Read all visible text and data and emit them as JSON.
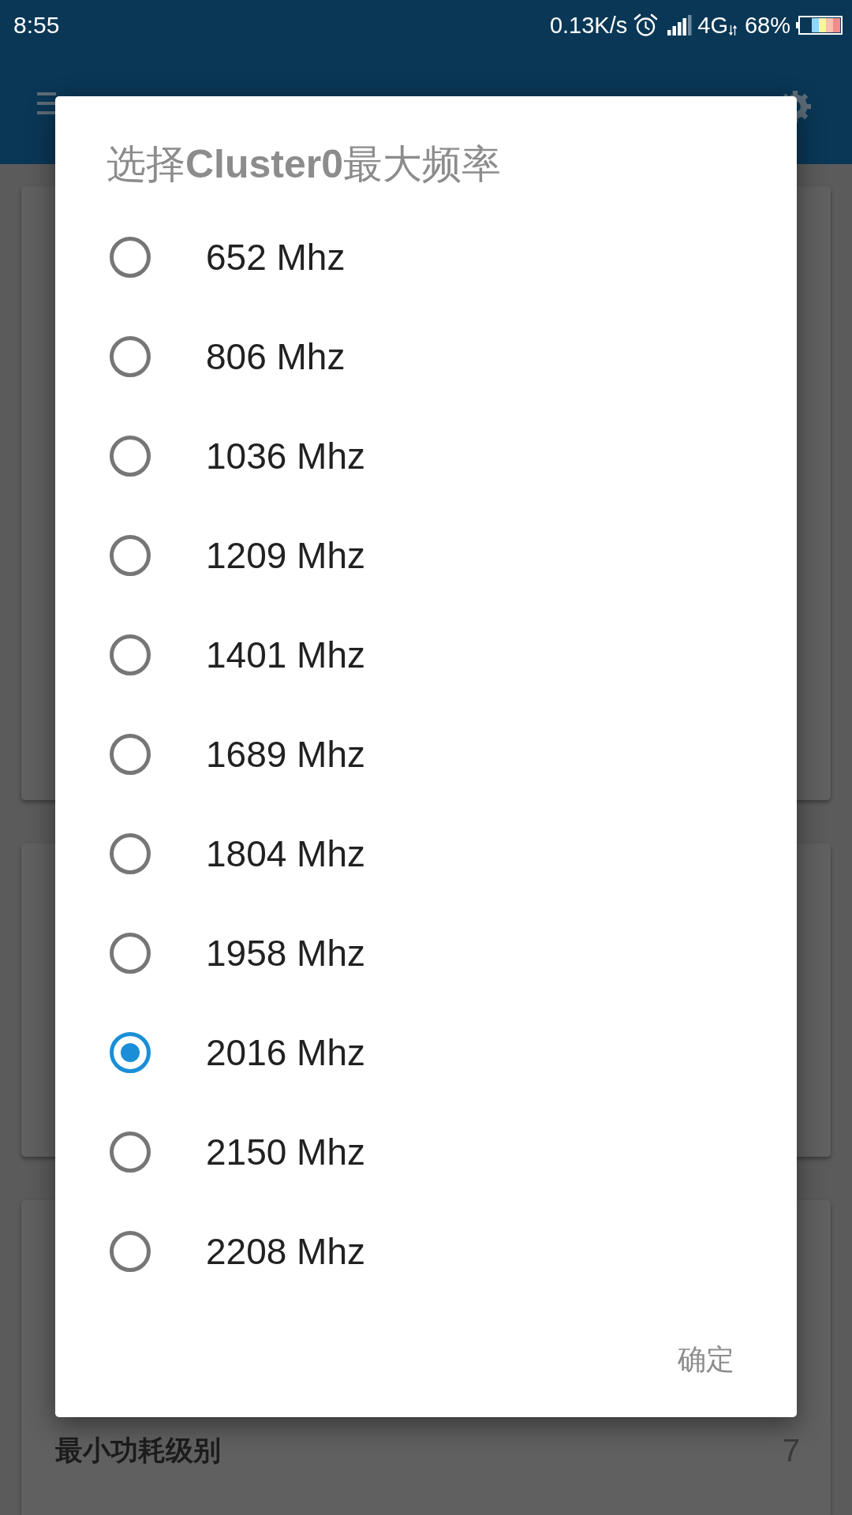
{
  "status_bar": {
    "time": "8:55",
    "network_speed": "0.13K/s",
    "network_type": "4G",
    "battery": "68%"
  },
  "background_rows": [
    {
      "label": "最小功耗级别",
      "value": "7"
    }
  ],
  "dialog": {
    "title": "选择**Cluster0**最大频率",
    "options": [
      {
        "label": "652 Mhz",
        "selected": false
      },
      {
        "label": "806 Mhz",
        "selected": false
      },
      {
        "label": "1036 Mhz",
        "selected": false
      },
      {
        "label": "1209 Mhz",
        "selected": false
      },
      {
        "label": "1401 Mhz",
        "selected": false
      },
      {
        "label": "1689 Mhz",
        "selected": false
      },
      {
        "label": "1804 Mhz",
        "selected": false
      },
      {
        "label": "1958 Mhz",
        "selected": false
      },
      {
        "label": "2016 Mhz",
        "selected": true
      },
      {
        "label": "2150 Mhz",
        "selected": false
      },
      {
        "label": "2208 Mhz",
        "selected": false
      }
    ],
    "buttons": [
      {
        "label": "确定"
      }
    ]
  }
}
